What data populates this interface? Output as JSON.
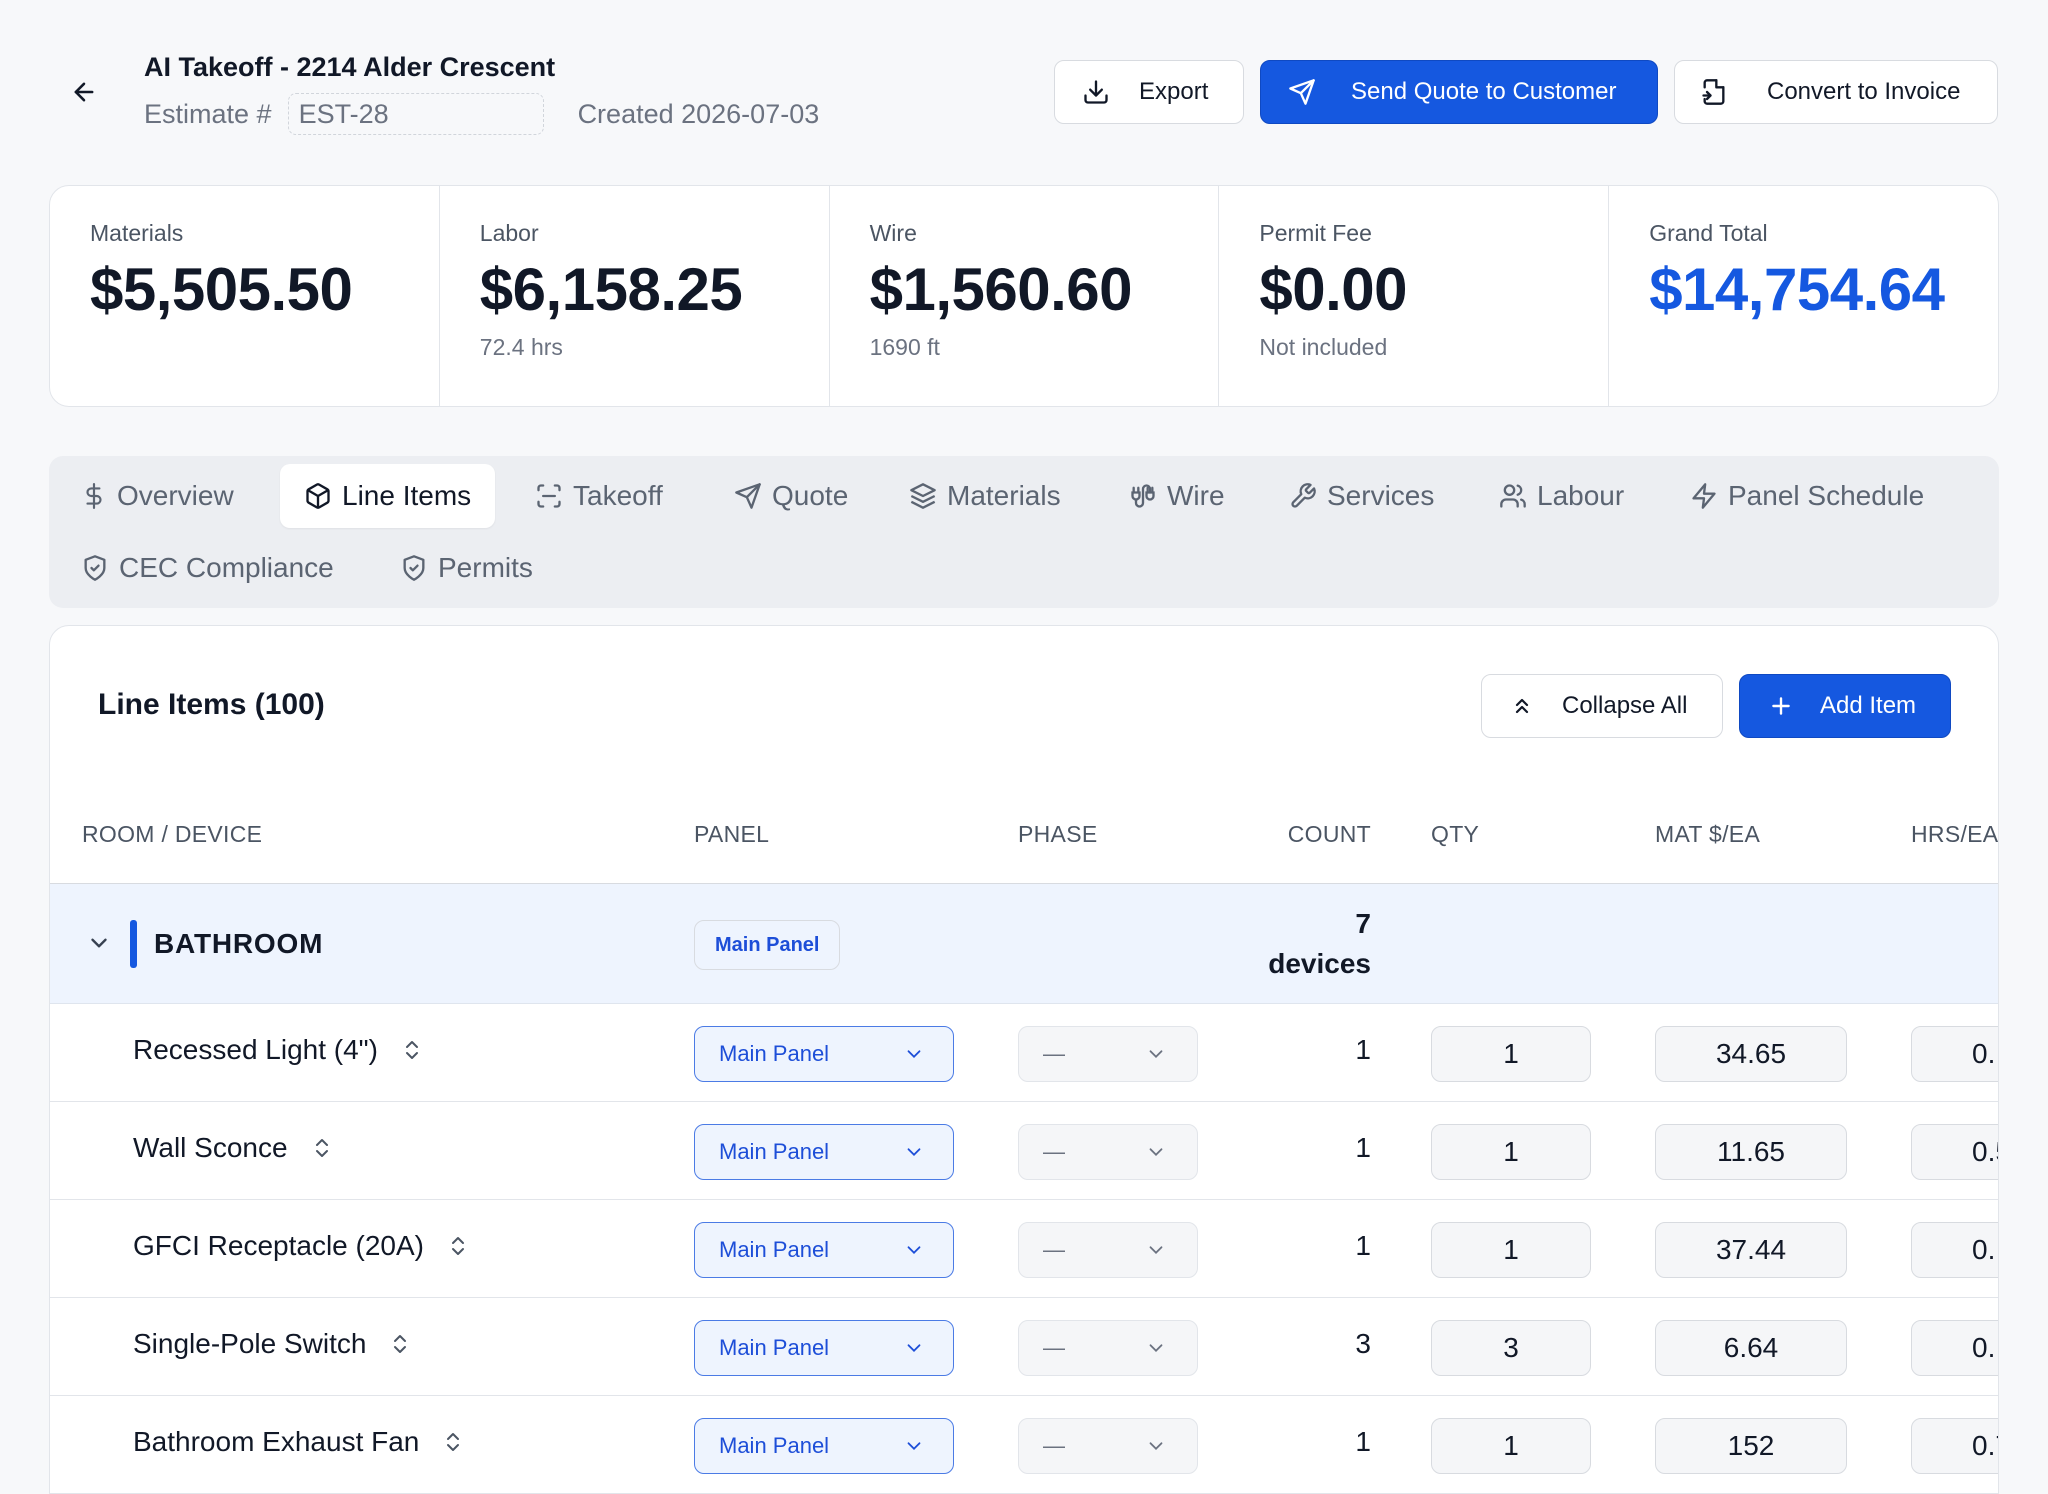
{
  "header": {
    "title": "AI Takeoff - 2214 Alder Crescent",
    "estimate_label": "Estimate #",
    "estimate_number": "EST-28",
    "created": "Created 2026-07-03",
    "export_label": "Export",
    "send_label": "Send Quote to Customer",
    "convert_label": "Convert to Invoice"
  },
  "summary": [
    {
      "label": "Materials",
      "value": "$5,505.50",
      "sub": ""
    },
    {
      "label": "Labor",
      "value": "$6,158.25",
      "sub": "72.4 hrs"
    },
    {
      "label": "Wire",
      "value": "$1,560.60",
      "sub": "1690 ft"
    },
    {
      "label": "Permit Fee",
      "value": "$0.00",
      "sub": "Not included"
    },
    {
      "label": "Grand Total",
      "value": "$14,754.64",
      "sub": ""
    }
  ],
  "tabs": [
    {
      "label": "Overview",
      "icon": "dollar-icon"
    },
    {
      "label": "Line Items",
      "icon": "box-icon",
      "active": true
    },
    {
      "label": "Takeoff",
      "icon": "scan-icon"
    },
    {
      "label": "Quote",
      "icon": "send-icon"
    },
    {
      "label": "Materials",
      "icon": "layers-icon"
    },
    {
      "label": "Wire",
      "icon": "cable-icon"
    },
    {
      "label": "Services",
      "icon": "wrench-icon"
    },
    {
      "label": "Labour",
      "icon": "users-icon"
    },
    {
      "label": "Panel Schedule",
      "icon": "zap-icon"
    },
    {
      "label": "CEC Compliance",
      "icon": "shield-check-icon"
    },
    {
      "label": "Permits",
      "icon": "shield-check-icon"
    }
  ],
  "line_items": {
    "title": "Line Items (100)",
    "collapse_label": "Collapse All",
    "add_label": "Add Item",
    "columns": [
      "ROOM / DEVICE",
      "PANEL",
      "PHASE",
      "COUNT",
      "QTY",
      "MAT $/EA",
      "HRS/EA"
    ],
    "group": {
      "name": "BATHROOM",
      "panel": "Main Panel",
      "count_num": "7",
      "count_unit": "devices"
    },
    "rows": [
      {
        "name": "Recessed Light (4\")",
        "panel": "Main Panel",
        "phase": "—",
        "count": "1",
        "qty": "1",
        "mat": "34.65",
        "hrs": "0."
      },
      {
        "name": "Wall Sconce",
        "panel": "Main Panel",
        "phase": "—",
        "count": "1",
        "qty": "1",
        "mat": "11.65",
        "hrs": "0.5"
      },
      {
        "name": "GFCI Receptacle (20A)",
        "panel": "Main Panel",
        "phase": "—",
        "count": "1",
        "qty": "1",
        "mat": "37.44",
        "hrs": "0."
      },
      {
        "name": "Single-Pole Switch",
        "panel": "Main Panel",
        "phase": "—",
        "count": "3",
        "qty": "3",
        "mat": "6.64",
        "hrs": "0."
      },
      {
        "name": "Bathroom Exhaust Fan",
        "panel": "Main Panel",
        "phase": "—",
        "count": "1",
        "qty": "1",
        "mat": "152",
        "hrs": "0.7"
      }
    ]
  },
  "colors": {
    "accent": "#1558e0",
    "background": "#f7f8fa",
    "group_bg": "#eef4fe"
  }
}
